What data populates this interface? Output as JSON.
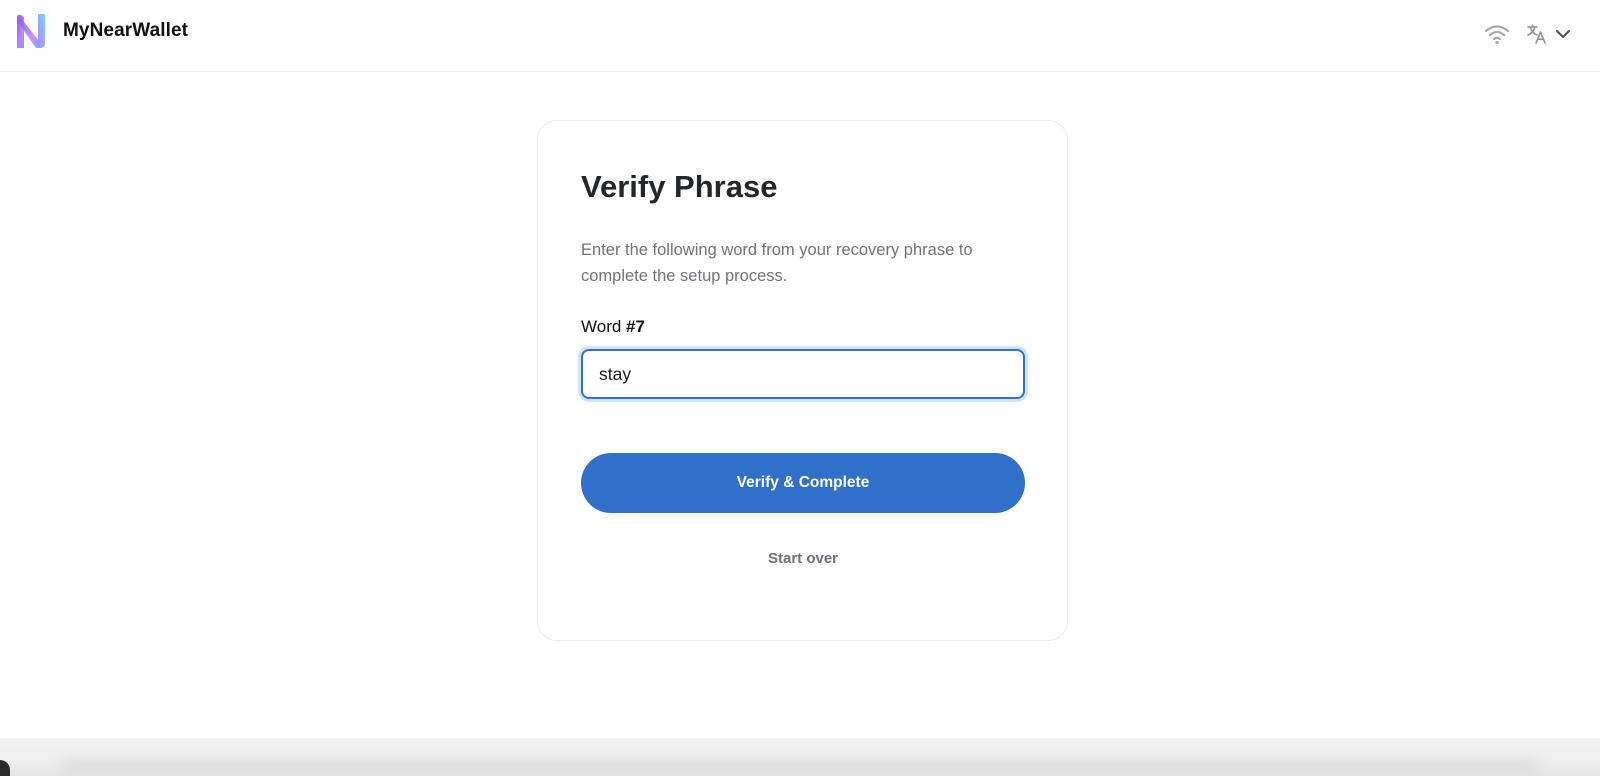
{
  "header": {
    "brand_name": "MyNearWallet",
    "icons": {
      "logo": "mynearwallet-logo",
      "network": "wifi-icon",
      "language": "translate-icon",
      "language_dropdown": "chevron-down-icon"
    }
  },
  "verify": {
    "title": "Verify Phrase",
    "description": "Enter the following word from your recovery phrase to complete the setup process.",
    "field_label_prefix": "Word ",
    "field_label_number": "#7",
    "input_value": "stay",
    "submit_label": "Verify & Complete",
    "start_over_label": "Start over"
  },
  "colors": {
    "primary": "#3070c9",
    "input_border": "#2f72c9",
    "title": "#24272a",
    "muted": "#72727a"
  }
}
